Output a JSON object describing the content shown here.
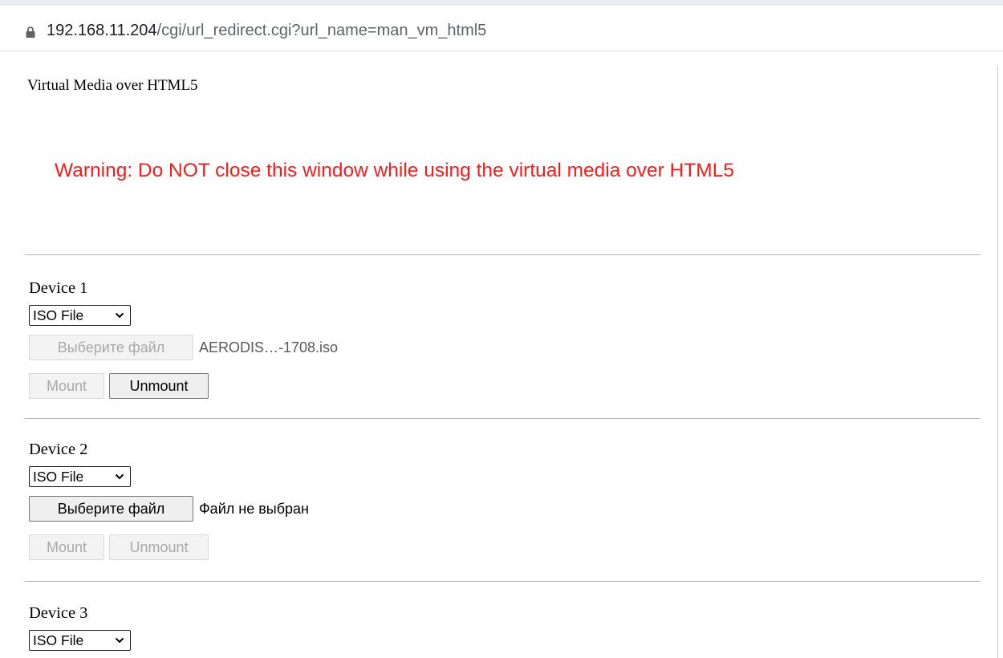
{
  "browser": {
    "url_host": "192.168.11.204",
    "url_path": "/cgi/url_redirect.cgi?url_name=man_vm_html5",
    "lock_icon": "lock-icon"
  },
  "page": {
    "title": "Virtual Media over HTML5",
    "warning": "Warning: Do NOT close this window while using the virtual media over HTML5",
    "warning_color": "#ff1a1a"
  },
  "devices": [
    {
      "label": "Device 1",
      "type": "ISO File",
      "choose_label": "Выберите файл",
      "choose_enabled": false,
      "file_name": "AERODIS…-1708.iso",
      "mount_label": "Mount",
      "mount_enabled": false,
      "unmount_label": "Unmount",
      "unmount_enabled": true
    },
    {
      "label": "Device 2",
      "type": "ISO File",
      "choose_label": "Выберите файл",
      "choose_enabled": true,
      "file_name": "Файл не выбран",
      "mount_label": "Mount",
      "mount_enabled": false,
      "unmount_label": "Unmount",
      "unmount_enabled": false
    },
    {
      "label": "Device 3",
      "type": "ISO File"
    }
  ]
}
